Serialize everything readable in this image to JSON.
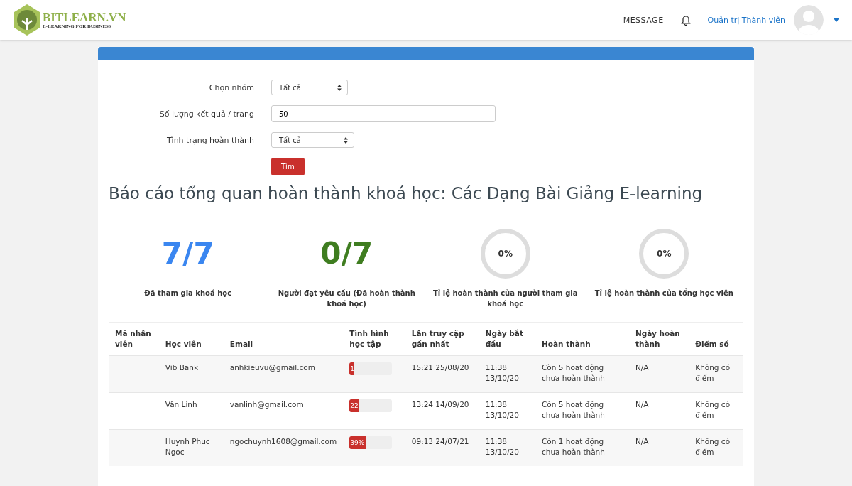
{
  "header": {
    "logo_title": "BITLEARN.VN",
    "logo_tagline": "E-LEARNING FOR BUSINESS",
    "message_link": "MESSAGE",
    "user_name": "Quản trị Thành viên"
  },
  "filters": [
    {
      "label": "Chọn nhóm",
      "kind": "select",
      "value": "Tất cả"
    },
    {
      "label": "Số lượng kết quả / trang",
      "kind": "text",
      "value": "50"
    },
    {
      "label": "Tình trạng hoàn thành",
      "kind": "select",
      "value": "Tất cả"
    }
  ],
  "search_button": "Tìm",
  "report_title": "Báo cáo tổng quan hoàn thành khoá học: Các Dạng Bài Giảng E-learning",
  "stats": [
    {
      "kind": "number",
      "value": "7/7",
      "color": "#3a86f0",
      "label": "Đã tham gia khoá học"
    },
    {
      "kind": "number",
      "value": "0/7",
      "color": "#3f7d20",
      "label": "Người đạt yêu cầu (Đã hoàn thành khoá học)"
    },
    {
      "kind": "ring",
      "value": "0%",
      "label": "Tỉ lệ hoàn thành của người tham gia khoá học"
    },
    {
      "kind": "ring",
      "value": "0%",
      "label": "Tỉ lệ hoàn thành của tổng học viên"
    }
  ],
  "table": {
    "columns": [
      "Mã nhân viên",
      "Học viên",
      "Email",
      "Tình hình học tập",
      "Lần truy cập gần nhất",
      "Ngày bắt đầu",
      "Hoàn thành",
      "Ngày hoàn thành",
      "Điểm số"
    ],
    "rows": [
      {
        "name": "Vib Bank",
        "email": "anhkieuvu@gmail.com",
        "progress": "1",
        "level": 0.01,
        "last_access": "15:21 25/08/20",
        "start": "11:38 13/10/20",
        "completion": "Còn 5 hoạt động chưa hoàn thành",
        "completed_on": "N/A",
        "score": "Không có điểm"
      },
      {
        "name": "Vân Linh",
        "email": "vanlinh@gmail.com",
        "progress": "22",
        "level": 0.22,
        "last_access": "13:24 14/09/20",
        "start": "11:38 13/10/20",
        "completion": "Còn 5 hoạt động chưa hoàn thành",
        "completed_on": "N/A",
        "score": "Không có điểm"
      },
      {
        "name": "Huynh Phuc Ngoc",
        "email": "ngochuynh1608@gmail.com",
        "progress": "39%",
        "level": 0.39,
        "last_access": "09:13 24/07/21",
        "start": "11:38 13/10/20",
        "completion": "Còn 1 hoạt động chưa hoàn thành",
        "completed_on": "N/A",
        "score": "Không có điểm"
      }
    ]
  }
}
